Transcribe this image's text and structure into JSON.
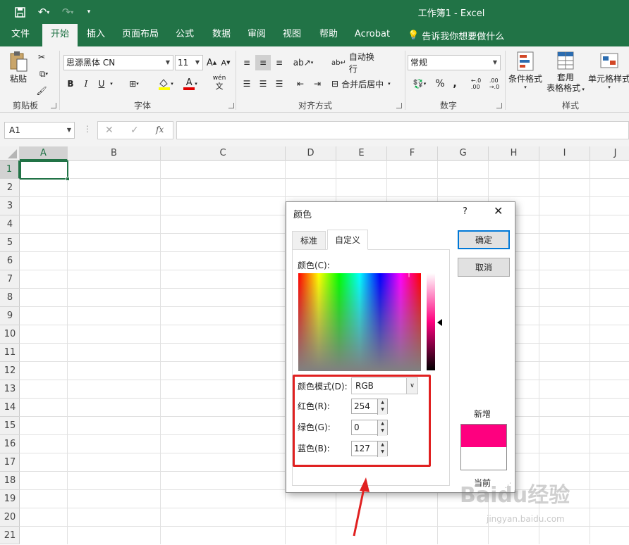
{
  "window": {
    "title": "工作簿1  -  Excel"
  },
  "ribbon_tabs": [
    "文件",
    "开始",
    "插入",
    "页面布局",
    "公式",
    "数据",
    "审阅",
    "视图",
    "帮助",
    "Acrobat"
  ],
  "tell_me": "告诉我你想要做什么",
  "clipboard": {
    "paste": "粘贴",
    "group": "剪贴板"
  },
  "font": {
    "name": "思源黑体 CN",
    "size": "11",
    "bold": "B",
    "italic": "I",
    "underline": "U",
    "grow": "A",
    "shrink": "A",
    "phonetic": "wén",
    "phonetic_char": "文",
    "font_color_letter": "A",
    "group": "字体"
  },
  "alignment": {
    "wrap": "自动换行",
    "merge": "合并后居中",
    "group": "对齐方式"
  },
  "number": {
    "format": "常规",
    "percent": "%",
    "comma": ",",
    "group": "数字"
  },
  "styles": {
    "conditional": "条件格式",
    "table_line1": "套用",
    "table_line2": "表格格式",
    "cell": "单元格样式",
    "group": "样式"
  },
  "formula_bar": {
    "name_box": "A1",
    "fx": "fx"
  },
  "columns": [
    "A",
    "B",
    "C",
    "D",
    "E",
    "F",
    "G",
    "H",
    "I",
    "J"
  ],
  "rows": [
    "1",
    "2",
    "3",
    "4",
    "5",
    "6",
    "7",
    "8",
    "9",
    "10",
    "11",
    "12",
    "13",
    "14",
    "15",
    "16",
    "17",
    "18",
    "19",
    "20",
    "21"
  ],
  "dialog": {
    "title": "颜色",
    "help": "?",
    "tabs": [
      "标准",
      "自定义"
    ],
    "colors_label": "颜色(C):",
    "color_mode_label": "颜色模式(D):",
    "color_mode_value": "RGB",
    "red_label": "红色(R):",
    "red_value": "254",
    "green_label": "绿色(G):",
    "green_value": "0",
    "blue_label": "蓝色(B):",
    "blue_value": "127",
    "ok": "确定",
    "cancel": "取消",
    "new_label": "新增",
    "current_label": "当前"
  },
  "watermark": {
    "brand": "Baidu经验",
    "url": "jingyan.baidu.com"
  },
  "colors": {
    "excel_green": "#217346",
    "new_color": "#fe007f",
    "current_color": "#ffffff",
    "highlight_red": "#e02020"
  }
}
